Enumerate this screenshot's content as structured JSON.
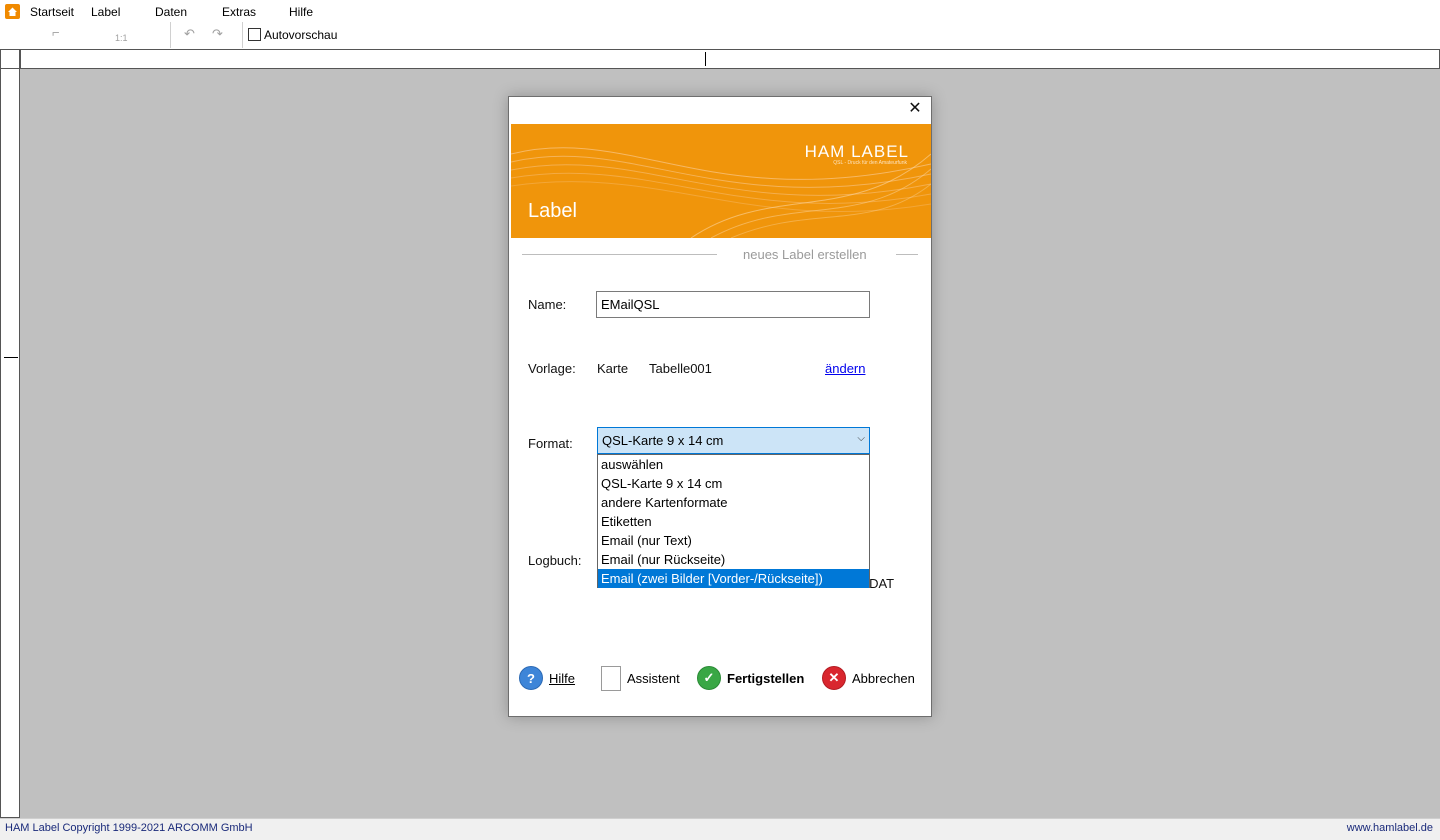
{
  "menu": {
    "items": [
      "Startseite",
      "Label",
      "Daten",
      "Extras",
      "Hilfe"
    ]
  },
  "toolbar": {
    "zoom_label": "1:1",
    "autopreview_label": "Autovorschau"
  },
  "dialog": {
    "banner_brand": "HAM LABEL",
    "banner_tagline": "QSL - Druck für den Amateurfunk",
    "banner_title": "Label",
    "section_title": "neues Label erstellen",
    "name_label": "Name:",
    "name_value": "EMailQSL",
    "template_label": "Vorlage:",
    "template_type": "Karte",
    "template_name": "Tabelle001",
    "change_link": "ändern",
    "format_label": "Format:",
    "format_selected": "QSL-Karte 9 x 14 cm",
    "format_options": [
      "auswählen",
      "QSL-Karte 9 x 14 cm",
      "andere Kartenformate",
      "Etiketten",
      "Email (nur Text)",
      "Email (nur Rückseite)",
      "Email (zwei Bilder [Vorder-/Rückseite])"
    ],
    "format_highlighted_index": 6,
    "logbook_label": "Logbuch:",
    "logbook_path_tail": "06.DAT",
    "buttons": {
      "help": "Hilfe",
      "assistant": "Assistent",
      "finish": "Fertigstellen",
      "cancel": "Abbrechen"
    }
  },
  "status": {
    "left": "HAM Label Copyright 1999-2021 ARCOMM GmbH",
    "right": "www.hamlabel.de"
  },
  "colors": {
    "banner": "#f0950b",
    "workspace": "#c0c0c0",
    "selection": "#0078d7"
  }
}
